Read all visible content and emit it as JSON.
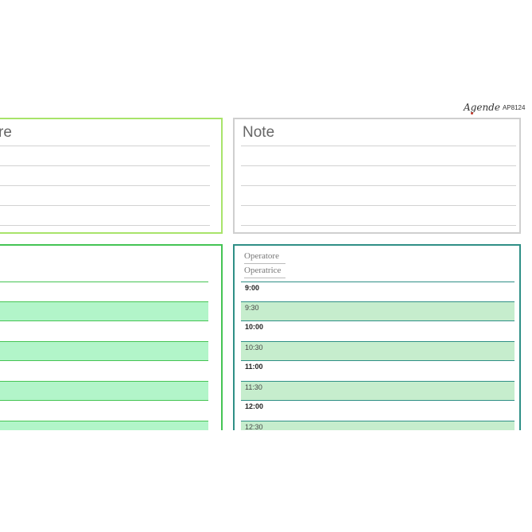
{
  "brand": {
    "logo_text": "Agende",
    "code": "AP8124"
  },
  "left_notes": {
    "partial_title": "re"
  },
  "right_notes": {
    "title": "Note"
  },
  "right_schedule": {
    "operator_label": "Operatore",
    "operatrice_label": "Operatrice",
    "slots": [
      "9:00",
      "9:30",
      "10:00",
      "10:30",
      "11:00",
      "11:30",
      "12:00",
      "12:30"
    ]
  },
  "colors": {
    "left_notes_border": "#a8e46a",
    "right_notes_border": "#cfcfcf",
    "left_schedule_border": "#45c454",
    "left_schedule_fill": "#b2f5c9",
    "right_schedule_border": "#2f8f86",
    "right_schedule_fill": "#c6edcd"
  }
}
